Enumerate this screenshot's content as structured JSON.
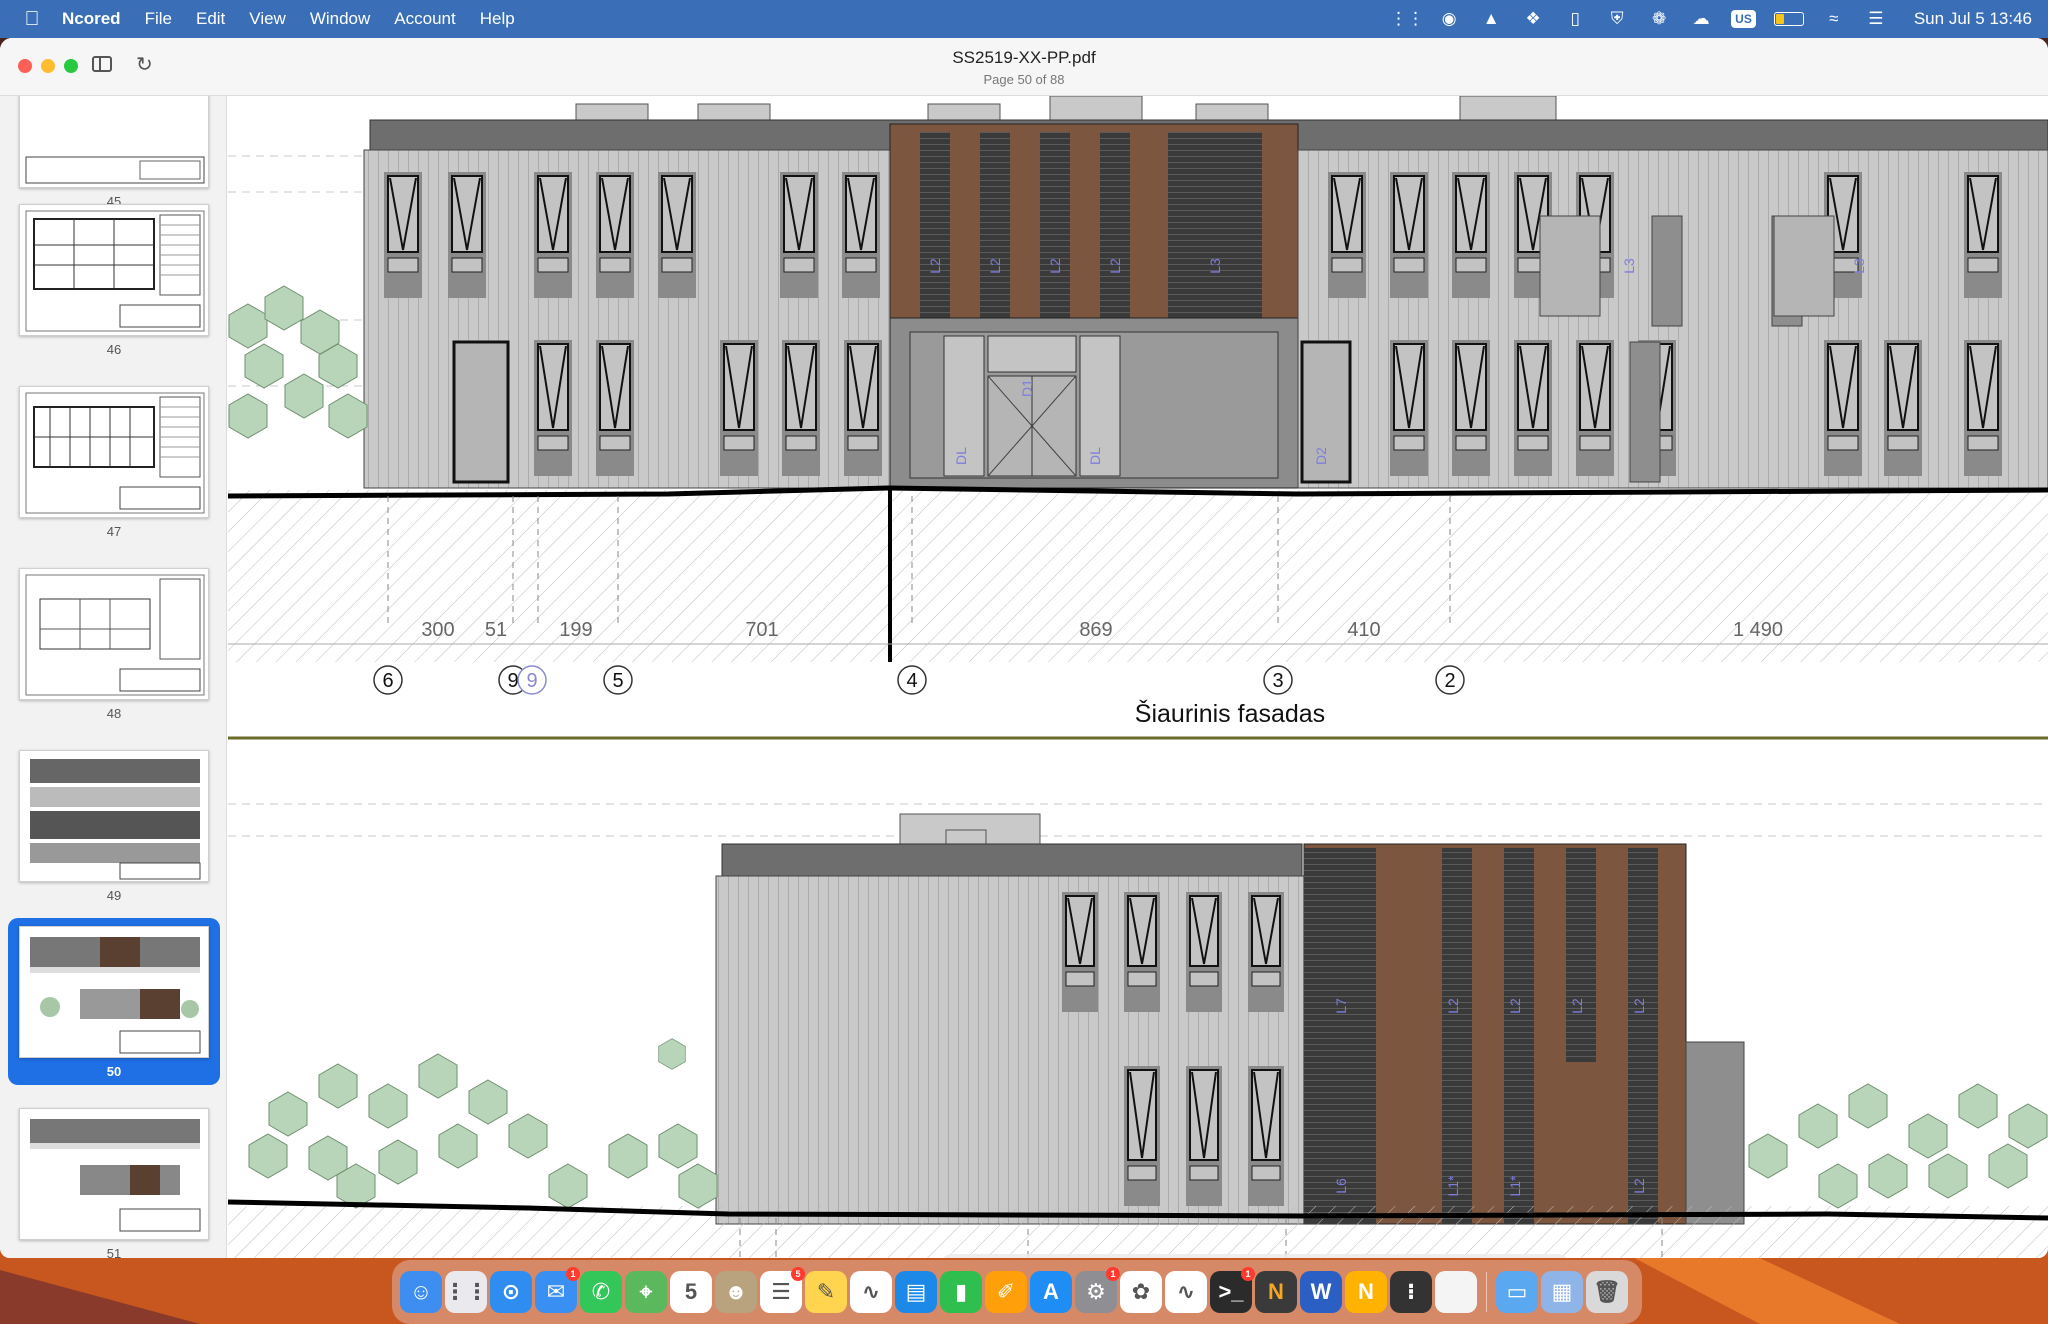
{
  "menubar": {
    "app_name": "Ncored",
    "menus": [
      "File",
      "Edit",
      "View",
      "Window",
      "Account",
      "Help"
    ],
    "input_source": "US",
    "battery_level": 0.3,
    "clock": "Sun Jul 5  13:46"
  },
  "window": {
    "title": "SS2519-XX-PP.pdf",
    "subtitle": "Page 50 of 88"
  },
  "sidebar": {
    "thumbnails": [
      {
        "page": "45",
        "selected": false
      },
      {
        "page": "46",
        "selected": false
      },
      {
        "page": "47",
        "selected": false
      },
      {
        "page": "48",
        "selected": false
      },
      {
        "page": "49",
        "selected": false
      },
      {
        "page": "50",
        "selected": true
      },
      {
        "page": "51",
        "selected": false
      }
    ]
  },
  "drawing": {
    "north_facade": {
      "title": "Šiaurinis fasadas",
      "dimensions": [
        "300",
        "51",
        "199",
        "701",
        "869",
        "410",
        "1 490"
      ],
      "grid_markers": [
        "6",
        "9",
        "9",
        "5",
        "4",
        "3",
        "2"
      ],
      "panel_labels": [
        "L2",
        "L2",
        "L2",
        "L2",
        "L3",
        "L3",
        "L3",
        "D1",
        "DL",
        "DL",
        "D2"
      ]
    },
    "lower_facade": {
      "panel_labels": [
        "L7",
        "L2",
        "L2",
        "L2",
        "L2",
        "L6",
        "L1*",
        "L1*",
        "L2"
      ]
    }
  },
  "toolbar": {
    "tools": [
      "select-arrow",
      "hand",
      "zoom-in",
      "zoom-out",
      "text",
      "text-box",
      "highlight",
      "strikethrough",
      "comment",
      "pen",
      "rectangle",
      "stamp",
      "eraser",
      "expand"
    ]
  },
  "dock": {
    "apps": [
      {
        "name": "finder",
        "color": "#3d8ef0",
        "badge": ""
      },
      {
        "name": "launchpad",
        "color": "#e9e9ee",
        "badge": ""
      },
      {
        "name": "safari",
        "color": "#2f8cf0",
        "badge": ""
      },
      {
        "name": "mail",
        "color": "#3a8ff2",
        "badge": "1"
      },
      {
        "name": "messages",
        "color": "#33c759",
        "badge": ""
      },
      {
        "name": "maps",
        "color": "#5cb85c",
        "badge": ""
      },
      {
        "name": "calendar",
        "color": "#ffffff",
        "badge": ""
      },
      {
        "name": "contacts",
        "color": "#b9a27e",
        "badge": ""
      },
      {
        "name": "reminders",
        "color": "#ffffff",
        "badge": "5"
      },
      {
        "name": "notes",
        "color": "#ffd54f",
        "badge": ""
      },
      {
        "name": "freeform",
        "color": "#ffffff",
        "badge": ""
      },
      {
        "name": "keynote",
        "color": "#1c88e8",
        "badge": ""
      },
      {
        "name": "numbers",
        "color": "#2fbf4f",
        "badge": ""
      },
      {
        "name": "pages",
        "color": "#ff9f0a",
        "badge": ""
      },
      {
        "name": "app-store",
        "color": "#1e8df5",
        "badge": ""
      },
      {
        "name": "system-settings",
        "color": "#8e8e93",
        "badge": "1"
      },
      {
        "name": "photos",
        "color": "#ffffff",
        "badge": ""
      },
      {
        "name": "preview",
        "color": "#ffffff",
        "badge": ""
      },
      {
        "name": "terminal",
        "color": "#2b2b2b",
        "badge": "1"
      },
      {
        "name": "ncored",
        "color": "#3a3a3a",
        "badge": ""
      },
      {
        "name": "word",
        "color": "#2b5fc4",
        "badge": ""
      },
      {
        "name": "ncored-alt",
        "color": "#ffb300",
        "badge": ""
      },
      {
        "name": "calculator",
        "color": "#333333",
        "badge": ""
      },
      {
        "name": "notes-blank",
        "color": "#f4f4f4",
        "badge": ""
      },
      {
        "name": "downloads-folder",
        "color": "#5aa9f0",
        "badge": ""
      },
      {
        "name": "screenshot-stack",
        "color": "#8fb4e8",
        "badge": ""
      },
      {
        "name": "trash",
        "color": "#d9d9d9",
        "badge": ""
      }
    ],
    "calendar_day": "5",
    "ncored_letter": "N"
  }
}
